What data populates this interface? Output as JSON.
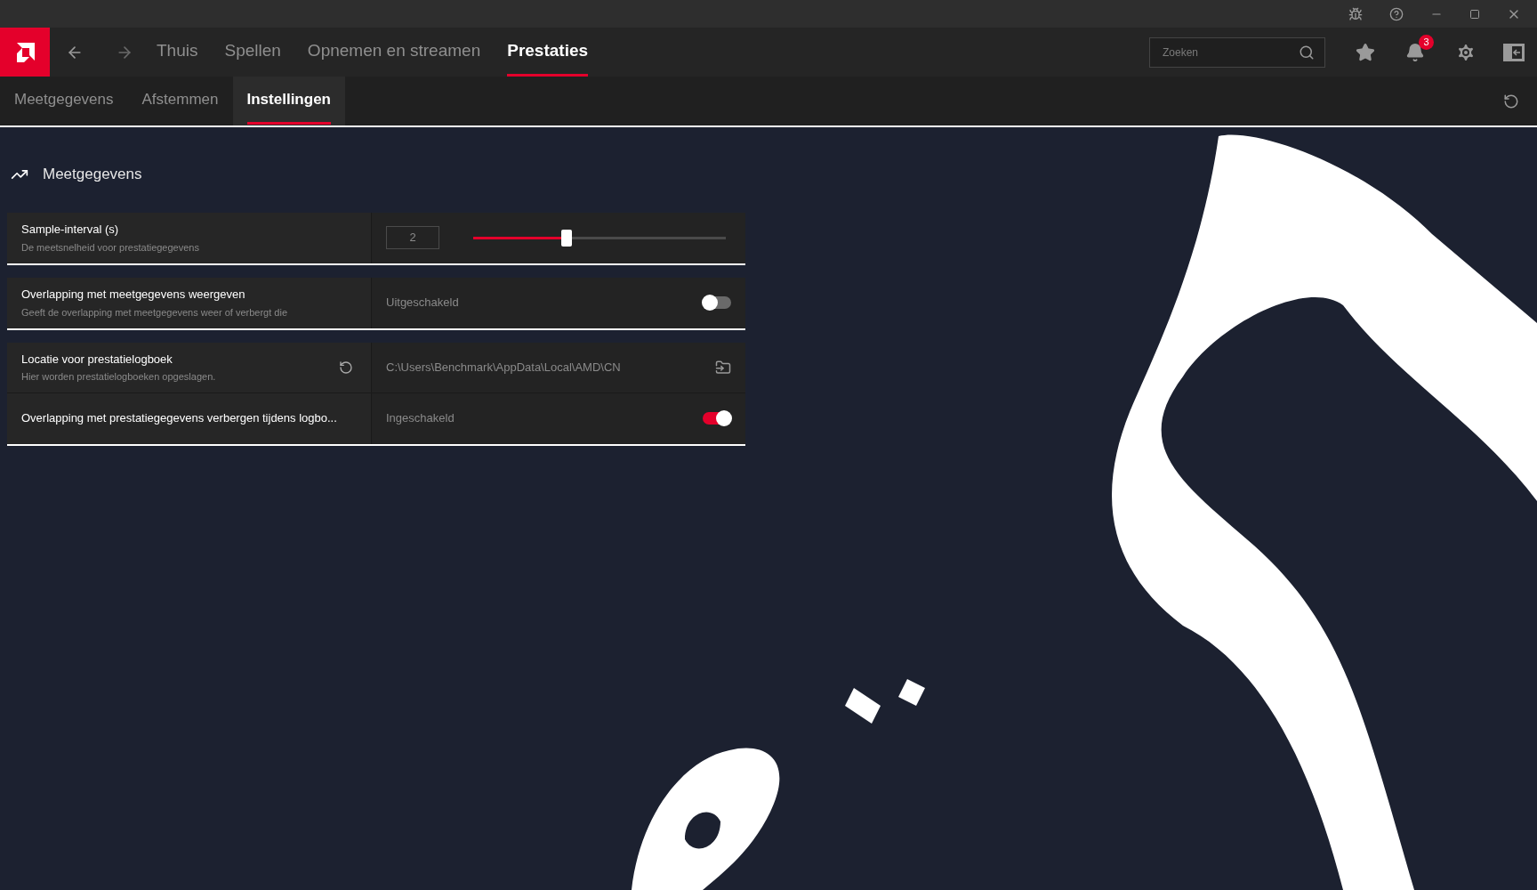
{
  "nav": {
    "items": [
      {
        "label": "Thuis",
        "selected": false
      },
      {
        "label": "Spellen",
        "selected": false
      },
      {
        "label": "Opnemen en streamen",
        "selected": false
      },
      {
        "label": "Prestaties",
        "selected": true
      }
    ],
    "search": {
      "placeholder": "Zoeken"
    },
    "notification_count": "3"
  },
  "subtabs": [
    {
      "label": "Meetgegevens",
      "selected": false
    },
    {
      "label": "Afstemmen",
      "selected": false
    },
    {
      "label": "Instellingen",
      "selected": true
    }
  ],
  "section": {
    "title": "Meetgegevens",
    "groups": [
      {
        "rows": [
          {
            "kind": "slider",
            "title": "Sample-interval (s)",
            "description": "De meetsnelheid voor prestatiegegevens",
            "value": "2",
            "level": 0.37
          }
        ]
      },
      {
        "rows": [
          {
            "kind": "toggle",
            "title": "Overlapping met meetgegevens weergeven",
            "description": "Geeft de overlapping met meetgegevens weer of verbergt die",
            "value": "Uitgeschakeld",
            "on": false
          }
        ]
      },
      {
        "rows": [
          {
            "kind": "path",
            "title": "Locatie voor prestatielogboek",
            "description": "Hier worden prestatielogboeken opgeslagen.",
            "value": "C:\\Users\\Benchmark\\AppData\\Local\\AMD\\CN"
          },
          {
            "kind": "toggle",
            "title": "Overlapping met prestatiegegevens verbergen tijdens logbo...",
            "value": "Ingeschakeld",
            "on": true
          }
        ]
      }
    ]
  }
}
